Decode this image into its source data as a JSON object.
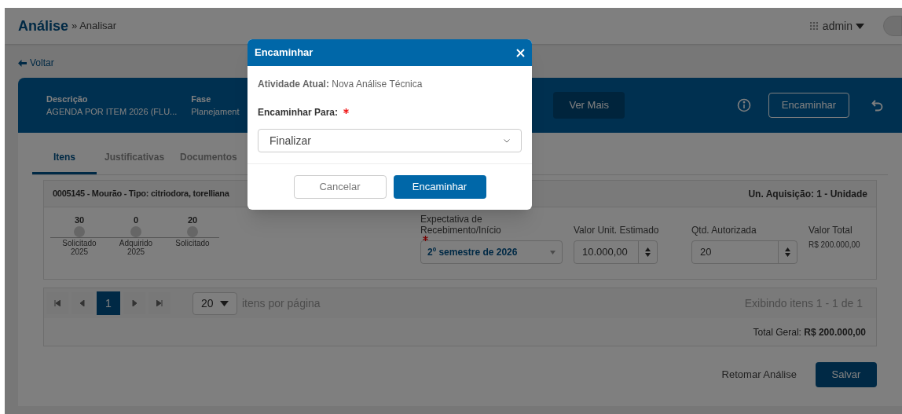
{
  "header": {
    "title": "Análise",
    "breadcrumb": "» Analisar",
    "user": "admin"
  },
  "back_link": "Voltar",
  "banner": {
    "fields": [
      {
        "label": "Descrição",
        "value": "AGENDA POR ITEM 2026 (FLU..."
      },
      {
        "label": "Fase",
        "value": "Planejament"
      }
    ],
    "more_button": "Ver Mais",
    "forward_button": "Encaminhar"
  },
  "tabs": [
    {
      "label": "Itens",
      "selected": true
    },
    {
      "label": "Justificativas",
      "selected": false
    },
    {
      "label": "Documentos",
      "selected": false
    }
  ],
  "item": {
    "title": "0005145 - Mourão - Tipo: citriodora, torelliana",
    "unit": "Un. Aquisição: 1 - Unidade",
    "timeline": [
      {
        "value": "30",
        "label": "Solicitado 2025"
      },
      {
        "value": "0",
        "label": "Adquirido 2025"
      },
      {
        "value": "20",
        "label": "Solicitado"
      }
    ],
    "expectation": {
      "label": "Expectativa de Recebimento/Início",
      "required": true,
      "value": "2º semestre de 2026"
    },
    "unit_value": {
      "label": "Valor Unit. Estimado",
      "value": "10.000,00"
    },
    "quantity": {
      "label": "Qtd. Autorizada",
      "value": "20"
    },
    "total": {
      "label": "Valor Total",
      "value": "R$ 200.000,00"
    }
  },
  "pagination": {
    "pages": [
      {
        "label": "1",
        "selected": true
      }
    ],
    "page_size": "20",
    "page_size_label": "itens por página",
    "summary": "Exibindo itens 1 - 1 de 1",
    "total": "Total Geral: **R$ 200.000,00**"
  },
  "actions": {
    "resume": "Retomar Análise",
    "save": "Salvar"
  },
  "modal": {
    "title": "Encaminhar",
    "current_activity": "**Atividade Atual:** Nova Análise Técnica",
    "target_label": "Encaminhar Para:",
    "target_required": true,
    "target_value": "Finalizar",
    "cancel": "Cancelar",
    "submit": "Encaminhar"
  }
}
